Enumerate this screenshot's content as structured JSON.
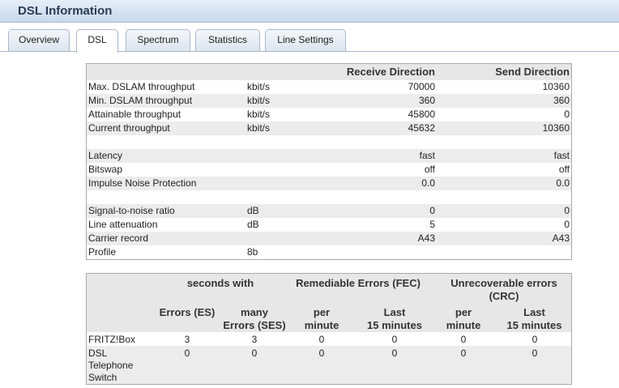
{
  "header": {
    "title": "DSL Information"
  },
  "tabs": [
    {
      "label": "Overview"
    },
    {
      "label": "DSL"
    },
    {
      "label": "Spectrum"
    },
    {
      "label": "Statistics"
    },
    {
      "label": "Line Settings"
    }
  ],
  "line_table": {
    "headers": {
      "receive": "Receive Direction",
      "send": "Send Direction"
    },
    "rows": [
      {
        "label": "Max. DSLAM throughput",
        "unit": "kbit/s",
        "rx": "70000",
        "tx": "10360"
      },
      {
        "label": "Min. DSLAM throughput",
        "unit": "kbit/s",
        "rx": "360",
        "tx": "360"
      },
      {
        "label": "Attainable throughput",
        "unit": "kbit/s",
        "rx": "45800",
        "tx": "0"
      },
      {
        "label": "Current throughput",
        "unit": "kbit/s",
        "rx": "45632",
        "tx": "10360"
      },
      {
        "label": "Latency",
        "unit": "",
        "rx": "fast",
        "tx": "fast"
      },
      {
        "label": "Bitswap",
        "unit": "",
        "rx": "off",
        "tx": "off"
      },
      {
        "label": "Impulse Noise Protection",
        "unit": "",
        "rx": "0.0",
        "tx": "0.0"
      },
      {
        "label": "Signal-to-noise ratio",
        "unit": "dB",
        "rx": "0",
        "tx": "0"
      },
      {
        "label": "Line attenuation",
        "unit": "dB",
        "rx": "5",
        "tx": "0"
      },
      {
        "label": "Carrier record",
        "unit": "",
        "rx": "A43",
        "tx": "A43"
      },
      {
        "label": "Profile",
        "unit": "8b",
        "rx": "",
        "tx": ""
      }
    ]
  },
  "error_table": {
    "group_headers": {
      "seconds": "seconds with",
      "fec": "Remediable Errors (FEC)",
      "crc_line1": "Unrecoverable errors",
      "crc_line2": "(CRC)"
    },
    "sub_headers": {
      "es": "Errors (ES)",
      "ses_line1": "many",
      "ses_line2": "Errors (SES)",
      "per": "per",
      "minute": "minute",
      "last": "Last",
      "fifteen": "15 minutes"
    },
    "rows": [
      {
        "label_lines": [
          "FRITZ!Box"
        ],
        "values": [
          "3",
          "3",
          "0",
          "0",
          "0",
          "0"
        ]
      },
      {
        "label_lines": [
          "DSL",
          "Telephone",
          "Switch"
        ],
        "values": [
          "0",
          "0",
          "0",
          "0",
          "0",
          "0"
        ]
      }
    ]
  }
}
